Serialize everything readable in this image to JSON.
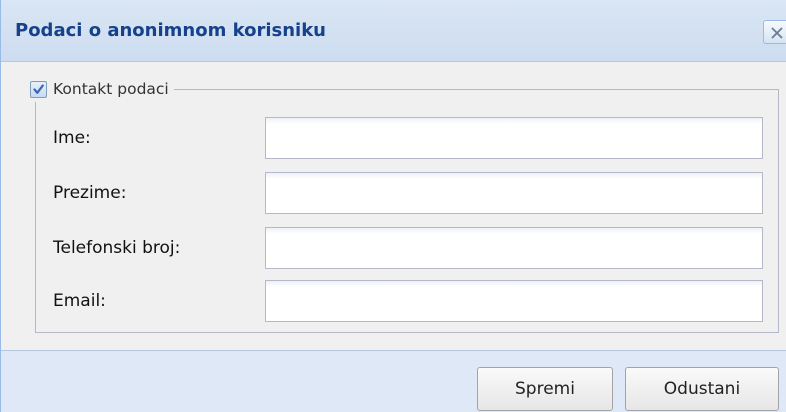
{
  "window": {
    "title": "Podaci o anonimnom korisniku",
    "close_icon": "close-icon"
  },
  "fieldset": {
    "legend": "Kontakt podaci",
    "checked": true,
    "fields": [
      {
        "label": "Ime:",
        "value": ""
      },
      {
        "label": "Prezime:",
        "value": ""
      },
      {
        "label": "Telefonski broj:",
        "value": ""
      },
      {
        "label": "Email:",
        "value": ""
      }
    ]
  },
  "footer": {
    "save_label": "Spremi",
    "cancel_label": "Odustani"
  },
  "colors": {
    "title": "#15428b",
    "window_bg": "#dfe8f6",
    "panel_bg": "#f0f0f0",
    "check": "#3a64b8"
  }
}
